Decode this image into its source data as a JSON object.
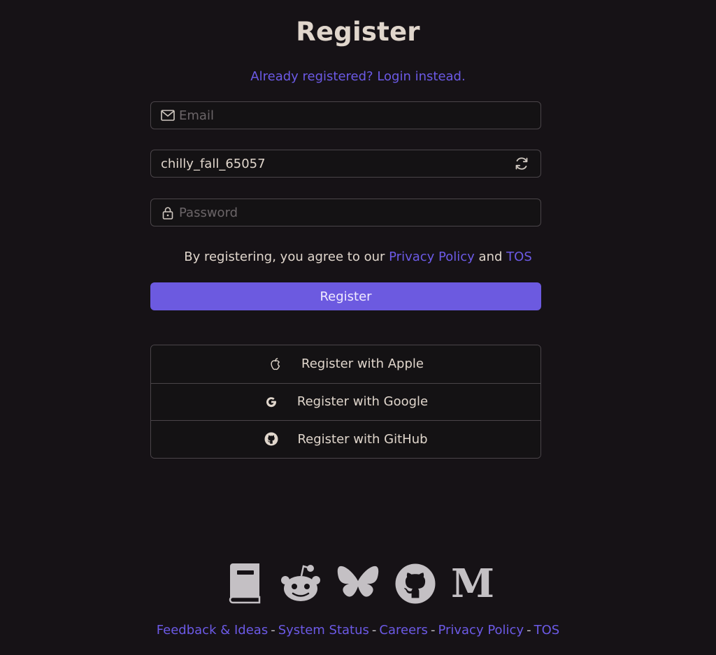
{
  "heading": "Register",
  "login_link": "Already registered? Login instead.",
  "form": {
    "email_placeholder": "Email",
    "username_value": "chilly_fall_65057",
    "password_placeholder": "Password"
  },
  "terms": {
    "prefix": "By registering, you agree to our",
    "privacy": "Privacy Policy",
    "and": "and",
    "tos": "TOS"
  },
  "register_button": "Register",
  "oauth": [
    {
      "label": "Register with Apple",
      "icon": "apple-icon"
    },
    {
      "label": "Register with Google",
      "icon": "google-icon"
    },
    {
      "label": "Register with GitHub",
      "icon": "github-icon"
    }
  ],
  "socials": [
    {
      "icon": "book-icon"
    },
    {
      "icon": "reddit-icon"
    },
    {
      "icon": "bluesky-icon"
    },
    {
      "icon": "github-icon"
    },
    {
      "icon": "medium-icon",
      "glyph": "M"
    }
  ],
  "footer": {
    "links": [
      "Feedback & Ideas",
      "System Status",
      "Careers",
      "Privacy Policy",
      "TOS"
    ],
    "separator": "-"
  },
  "colors": {
    "background": "#161216",
    "accent": "#6c5ae6",
    "text": "#e0d6cc",
    "border": "#4a4549",
    "icon": "#c4c0c4"
  }
}
